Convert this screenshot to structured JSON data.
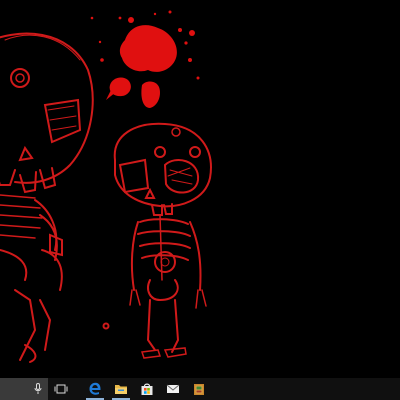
{
  "desktop": {
    "wallpaper": "red-line-skeleton-sketch-on-black",
    "accent": "#d01a1a",
    "splatter": "#e01010"
  },
  "taskbar": {
    "background": "#101010",
    "search": {
      "icon": "microphone-icon"
    },
    "items": [
      {
        "name": "task-view",
        "icon": "task-view-icon"
      },
      {
        "name": "edge",
        "icon": "edge-icon",
        "active": true
      },
      {
        "name": "file-explorer",
        "icon": "folder-icon",
        "active": true
      },
      {
        "name": "store",
        "icon": "store-icon"
      },
      {
        "name": "mail",
        "icon": "mail-icon"
      },
      {
        "name": "app",
        "icon": "app-icon"
      }
    ]
  }
}
